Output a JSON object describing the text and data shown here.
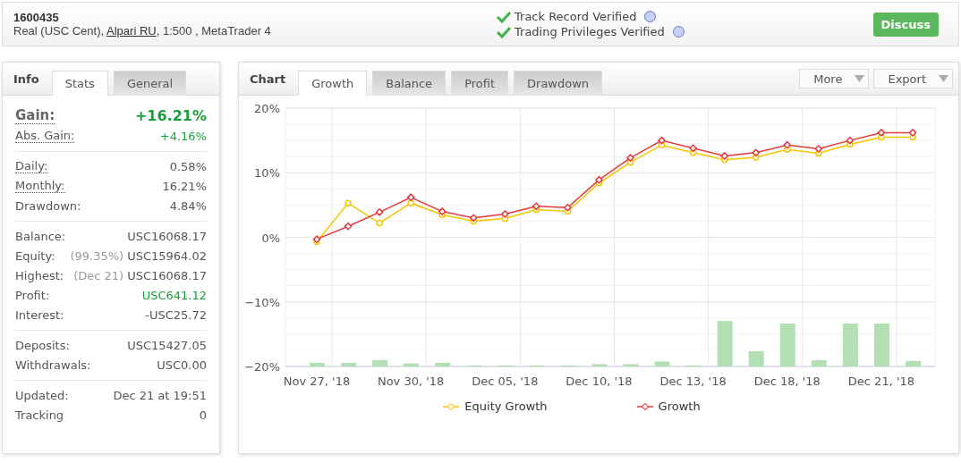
{
  "header": {
    "account": "1600435",
    "details": [
      {
        "text": "Real (USC Cent), ",
        "link": false
      },
      {
        "text": "Alpari RU",
        "link": true
      },
      {
        "text": ", 1:500 , MetaTrader 4",
        "link": false
      }
    ],
    "verifications": [
      {
        "label": "Track Record Verified",
        "checked": true
      },
      {
        "label": "Trading Privileges Verified",
        "checked": true
      }
    ],
    "discuss_button": "Discuss"
  },
  "info_panel": {
    "title": "Info",
    "tabs": [
      {
        "label": "Stats",
        "selected": true
      },
      {
        "label": "General",
        "selected": false
      }
    ],
    "groups": [
      {
        "rows": [
          {
            "label": "Gain:",
            "value": "+16.21%",
            "kind": "headline",
            "positive": true,
            "dotted": true
          },
          {
            "label": "Abs. Gain:",
            "value": "+4.16%",
            "kind": "plain",
            "positive": true,
            "dotted": true
          }
        ]
      },
      {
        "rows": [
          {
            "label": "Daily:",
            "value": "0.58%",
            "kind": "plain",
            "positive": false,
            "dotted": true
          },
          {
            "label": "Monthly:",
            "value": "16.21%",
            "kind": "plain",
            "positive": false,
            "dotted": true
          },
          {
            "label": "Drawdown:",
            "value": "4.84%",
            "kind": "plain",
            "positive": false,
            "dotted": false
          }
        ]
      },
      {
        "rows": [
          {
            "label": "Balance:",
            "value": "USC16068.17",
            "kind": "plain",
            "positive": false,
            "dotted": false
          },
          {
            "label": "Equity:",
            "note": "(99.35%)",
            "value": "USC15964.02",
            "kind": "plain",
            "positive": false,
            "dotted": false
          },
          {
            "label": "Highest:",
            "note": "(Dec 21)",
            "value": "USC16068.17",
            "kind": "plain",
            "positive": false,
            "dotted": false
          },
          {
            "label": "Profit:",
            "value": "USC641.12",
            "kind": "plain",
            "positive": true,
            "dotted": false
          },
          {
            "label": "Interest:",
            "value": "-USC25.72",
            "kind": "plain",
            "positive": false,
            "dotted": false
          }
        ]
      },
      {
        "rows": [
          {
            "label": "Deposits:",
            "value": "USC15427.05",
            "kind": "plain",
            "positive": false,
            "dotted": false
          },
          {
            "label": "Withdrawals:",
            "value": "USC0.00",
            "kind": "plain",
            "positive": false,
            "dotted": false
          }
        ]
      },
      {
        "rows": [
          {
            "label": "Updated:",
            "value": "Dec 21 at 19:51",
            "kind": "plain",
            "positive": false,
            "dotted": false
          },
          {
            "label": "Tracking",
            "value": "0",
            "kind": "plain",
            "positive": false,
            "dotted": false
          }
        ]
      }
    ]
  },
  "chart_panel": {
    "title": "Chart",
    "tabs": [
      {
        "label": "Growth",
        "selected": true
      },
      {
        "label": "Balance",
        "selected": false
      },
      {
        "label": "Profit",
        "selected": false
      },
      {
        "label": "Drawdown",
        "selected": false
      }
    ],
    "menus": [
      "More",
      "Export"
    ],
    "chart_data": {
      "type": "line",
      "categories": [
        "Nov 27, '18",
        null,
        null,
        "Nov 30, '18",
        null,
        null,
        "Dec 05, '18",
        null,
        null,
        "Dec 10, '18",
        null,
        null,
        "Dec 13, '18",
        null,
        null,
        "Dec 18, '18",
        null,
        null,
        "Dec 21, '18",
        null
      ],
      "ylim": [
        -20,
        20
      ],
      "grid": true,
      "yticks": [
        {
          "value": 20,
          "label": "20%"
        },
        {
          "value": 10,
          "label": "10%"
        },
        {
          "value": 0,
          "label": "0%"
        },
        {
          "value": -10,
          "label": "−10%"
        },
        {
          "value": -20,
          "label": "−20%"
        }
      ],
      "series": [
        {
          "name": "Equity Growth",
          "color": "#f5c400",
          "marker": "circle",
          "values": [
            -0.7,
            5.3,
            2.2,
            5.3,
            3.5,
            2.5,
            2.9,
            4.3,
            4.0,
            8.4,
            11.6,
            14.3,
            13.1,
            12.0,
            12.4,
            13.6,
            13.0,
            14.4,
            15.5,
            15.5
          ]
        },
        {
          "name": "Growth",
          "color": "#e8383d",
          "marker": "diamond",
          "values": [
            -0.3,
            1.7,
            3.9,
            6.2,
            4.0,
            3.0,
            3.6,
            4.8,
            4.6,
            8.9,
            12.3,
            15.0,
            13.8,
            12.6,
            13.1,
            14.3,
            13.7,
            15.0,
            16.2,
            16.2
          ]
        }
      ]
    }
  }
}
